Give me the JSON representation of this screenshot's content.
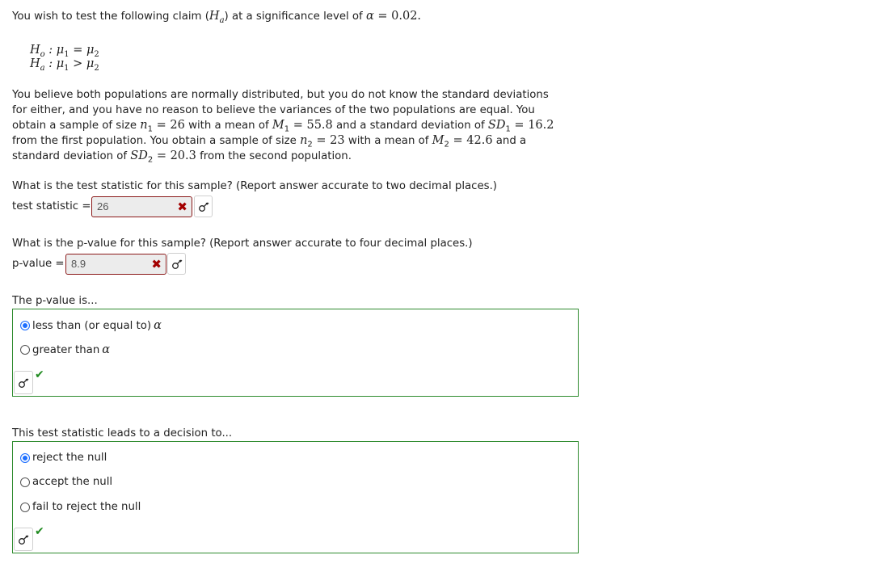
{
  "intro": {
    "text_before": "You wish to test the following claim (",
    "ha_symbol": "H",
    "ha_sub": "a",
    "text_middle": ") at a significance level of ",
    "alpha_symbol": "α",
    "equals": " = ",
    "alpha_value": "0.02."
  },
  "hypotheses": {
    "null": {
      "H": "H",
      "sub": "o",
      "rest": " : μ",
      "s1": "1",
      "op": " = μ",
      "s2": "2"
    },
    "alt": {
      "H": "H",
      "sub": "a",
      "rest": " : μ",
      "s1": "1",
      "op": " > μ",
      "s2": "2"
    }
  },
  "paragraph": {
    "line1": "You believe both populations are normally distributed, but you do not know the standard deviations",
    "line2": "for either, and you have no reason to believe the variances of the two populations are equal. You",
    "line3_a": "obtain a sample of size ",
    "n1_label": "n",
    "n1_sub": "1",
    "n1_value": " = 26",
    "line3_b": " with a mean of ",
    "m1_label": "M",
    "m1_sub": "1",
    "m1_value": " = 55.8",
    "line3_c": " and a standard deviation of ",
    "sd1_label": "SD",
    "sd1_sub": "1",
    "sd1_value": " = 16.2",
    "line4_a": "from the first population. You obtain a sample of size ",
    "n2_label": "n",
    "n2_sub": "2",
    "n2_value": " = 23",
    "line4_b": " with a mean of ",
    "m2_label": "M",
    "m2_sub": "2",
    "m2_value": " = 42.6",
    "line4_c": " and a",
    "line5_a": "standard deviation of ",
    "sd2_label": "SD",
    "sd2_sub": "2",
    "sd2_value": " = 20.3",
    "line5_b": " from the second population."
  },
  "q1": {
    "prompt": "What is the test statistic for this sample? (Report answer accurate to two decimal places.)",
    "label": "test statistic = ",
    "value": "26",
    "status_icon": "✖"
  },
  "q2": {
    "prompt": "What is the p-value for this sample? (Report answer accurate to four decimal places.)",
    "label": "p-value = ",
    "value": "8.9",
    "status_icon": "✖"
  },
  "q3": {
    "prompt": "The p-value is...",
    "options": [
      {
        "label": "less than (or equal to) ",
        "alpha": "α",
        "checked": true
      },
      {
        "label": "greater than ",
        "alpha": "α",
        "checked": false
      }
    ],
    "status_icon": "✔"
  },
  "q4": {
    "prompt": "This test statistic leads to a decision to...",
    "options": [
      {
        "label": "reject the null",
        "checked": true
      },
      {
        "label": "accept the null",
        "checked": false
      },
      {
        "label": "fail to reject the null",
        "checked": false
      }
    ],
    "status_icon": "✔"
  }
}
